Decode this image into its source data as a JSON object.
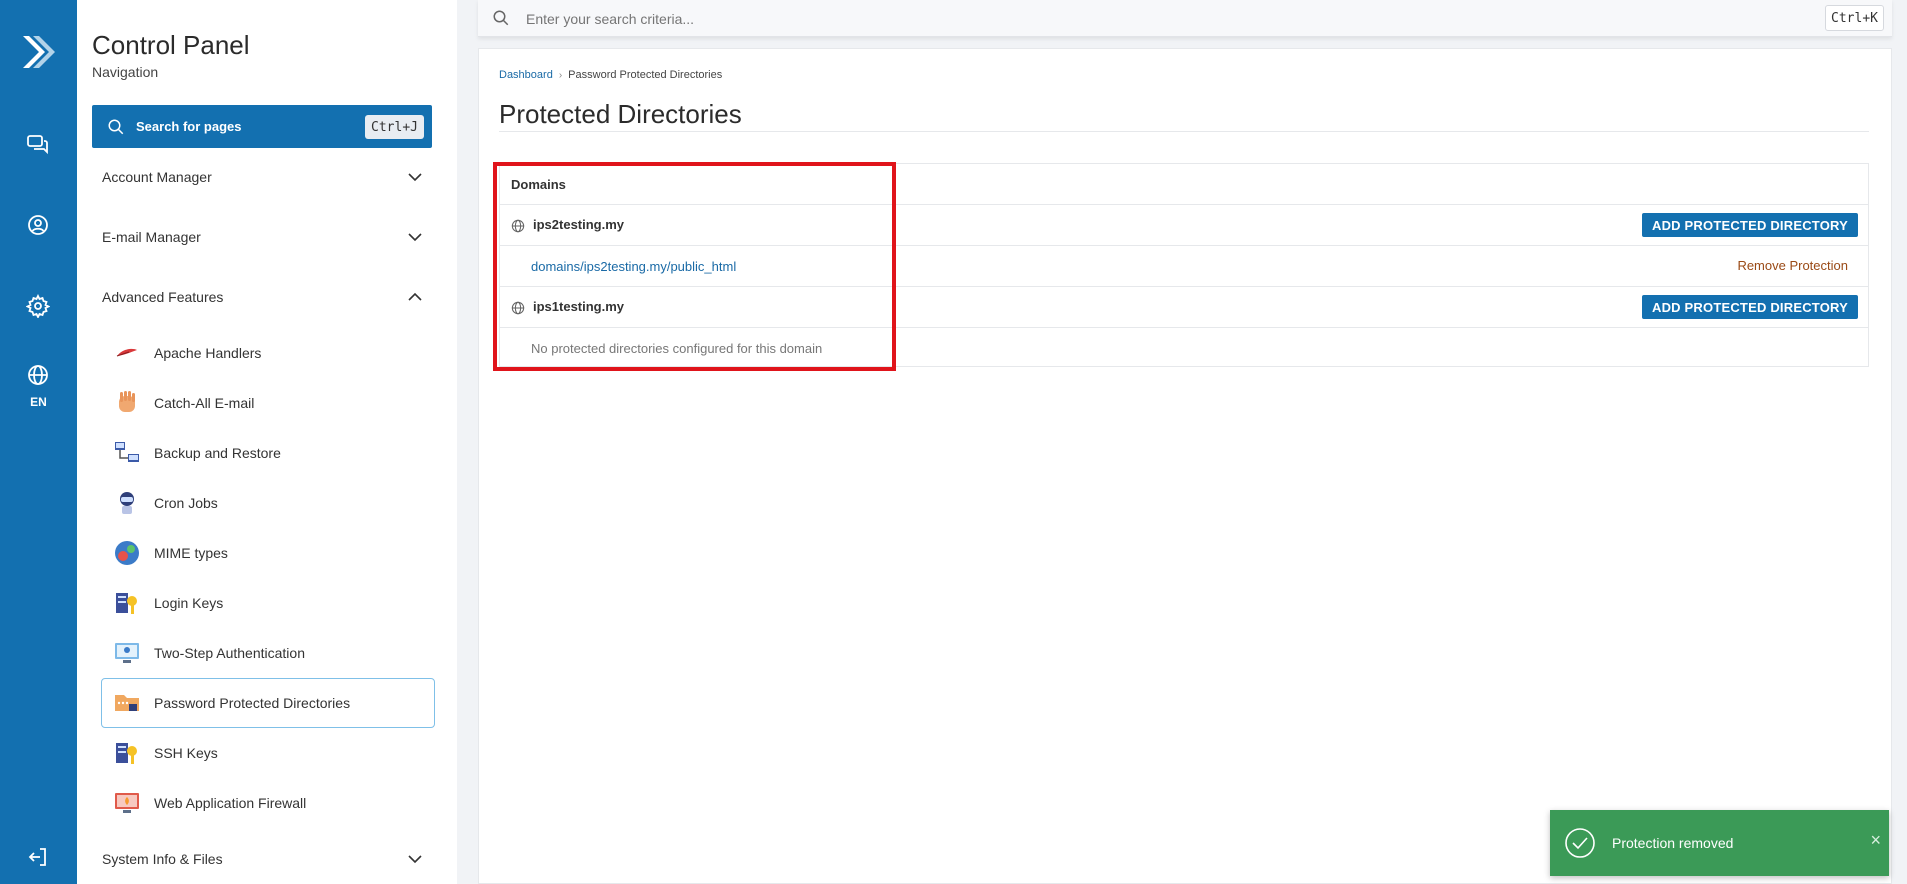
{
  "rail": {
    "language": "EN",
    "icons": [
      "logo-icon",
      "chat-icon",
      "user-icon",
      "gear-icon",
      "globe-icon",
      "logout-icon"
    ]
  },
  "sidebar": {
    "title": "Control Panel",
    "subtitle": "Navigation",
    "search_label": "Search for pages",
    "search_shortcut": "Ctrl+J",
    "sections": [
      {
        "label": "Account Manager",
        "expanded": false
      },
      {
        "label": "E-mail Manager",
        "expanded": false
      },
      {
        "label": "Advanced Features",
        "expanded": true
      },
      {
        "label": "System Info & Files",
        "expanded": false
      }
    ],
    "items": [
      {
        "label": "Apache Handlers",
        "icon": "feather-icon"
      },
      {
        "label": "Catch-All E-mail",
        "icon": "hand-icon"
      },
      {
        "label": "Backup and Restore",
        "icon": "network-icon"
      },
      {
        "label": "Cron Jobs",
        "icon": "robot-icon"
      },
      {
        "label": "MIME types",
        "icon": "mime-icon"
      },
      {
        "label": "Login Keys",
        "icon": "key-icon"
      },
      {
        "label": "Two-Step Authentication",
        "icon": "monitor-icon"
      },
      {
        "label": "Password Protected Directories",
        "icon": "folder-lock-icon",
        "active": true
      },
      {
        "label": "SSH Keys",
        "icon": "key-icon"
      },
      {
        "label": "Web Application Firewall",
        "icon": "firewall-icon"
      }
    ]
  },
  "topbar": {
    "search_placeholder": "Enter your search criteria...",
    "shortcut": "Ctrl+K"
  },
  "main": {
    "breadcrumb": [
      "Dashboard",
      "Password Protected Directories"
    ],
    "title": "Protected Directories",
    "table": {
      "header": "Domains",
      "rows": [
        {
          "type": "domain",
          "label": "ips2testing.my",
          "action": "ADD PROTECTED DIRECTORY"
        },
        {
          "type": "dir",
          "label": "domains/ips2testing.my/public_html",
          "action": "Remove Protection"
        },
        {
          "type": "domain",
          "label": "ips1testing.my",
          "action": "ADD PROTECTED DIRECTORY"
        },
        {
          "type": "empty",
          "label": "No protected directories configured for this domain"
        }
      ]
    }
  },
  "toast": {
    "message": "Protection removed",
    "close": "×"
  },
  "colors": {
    "brand": "#1370b0",
    "success": "#3b9a57",
    "highlight": "#e0141b",
    "remove": "#9a4a16"
  }
}
